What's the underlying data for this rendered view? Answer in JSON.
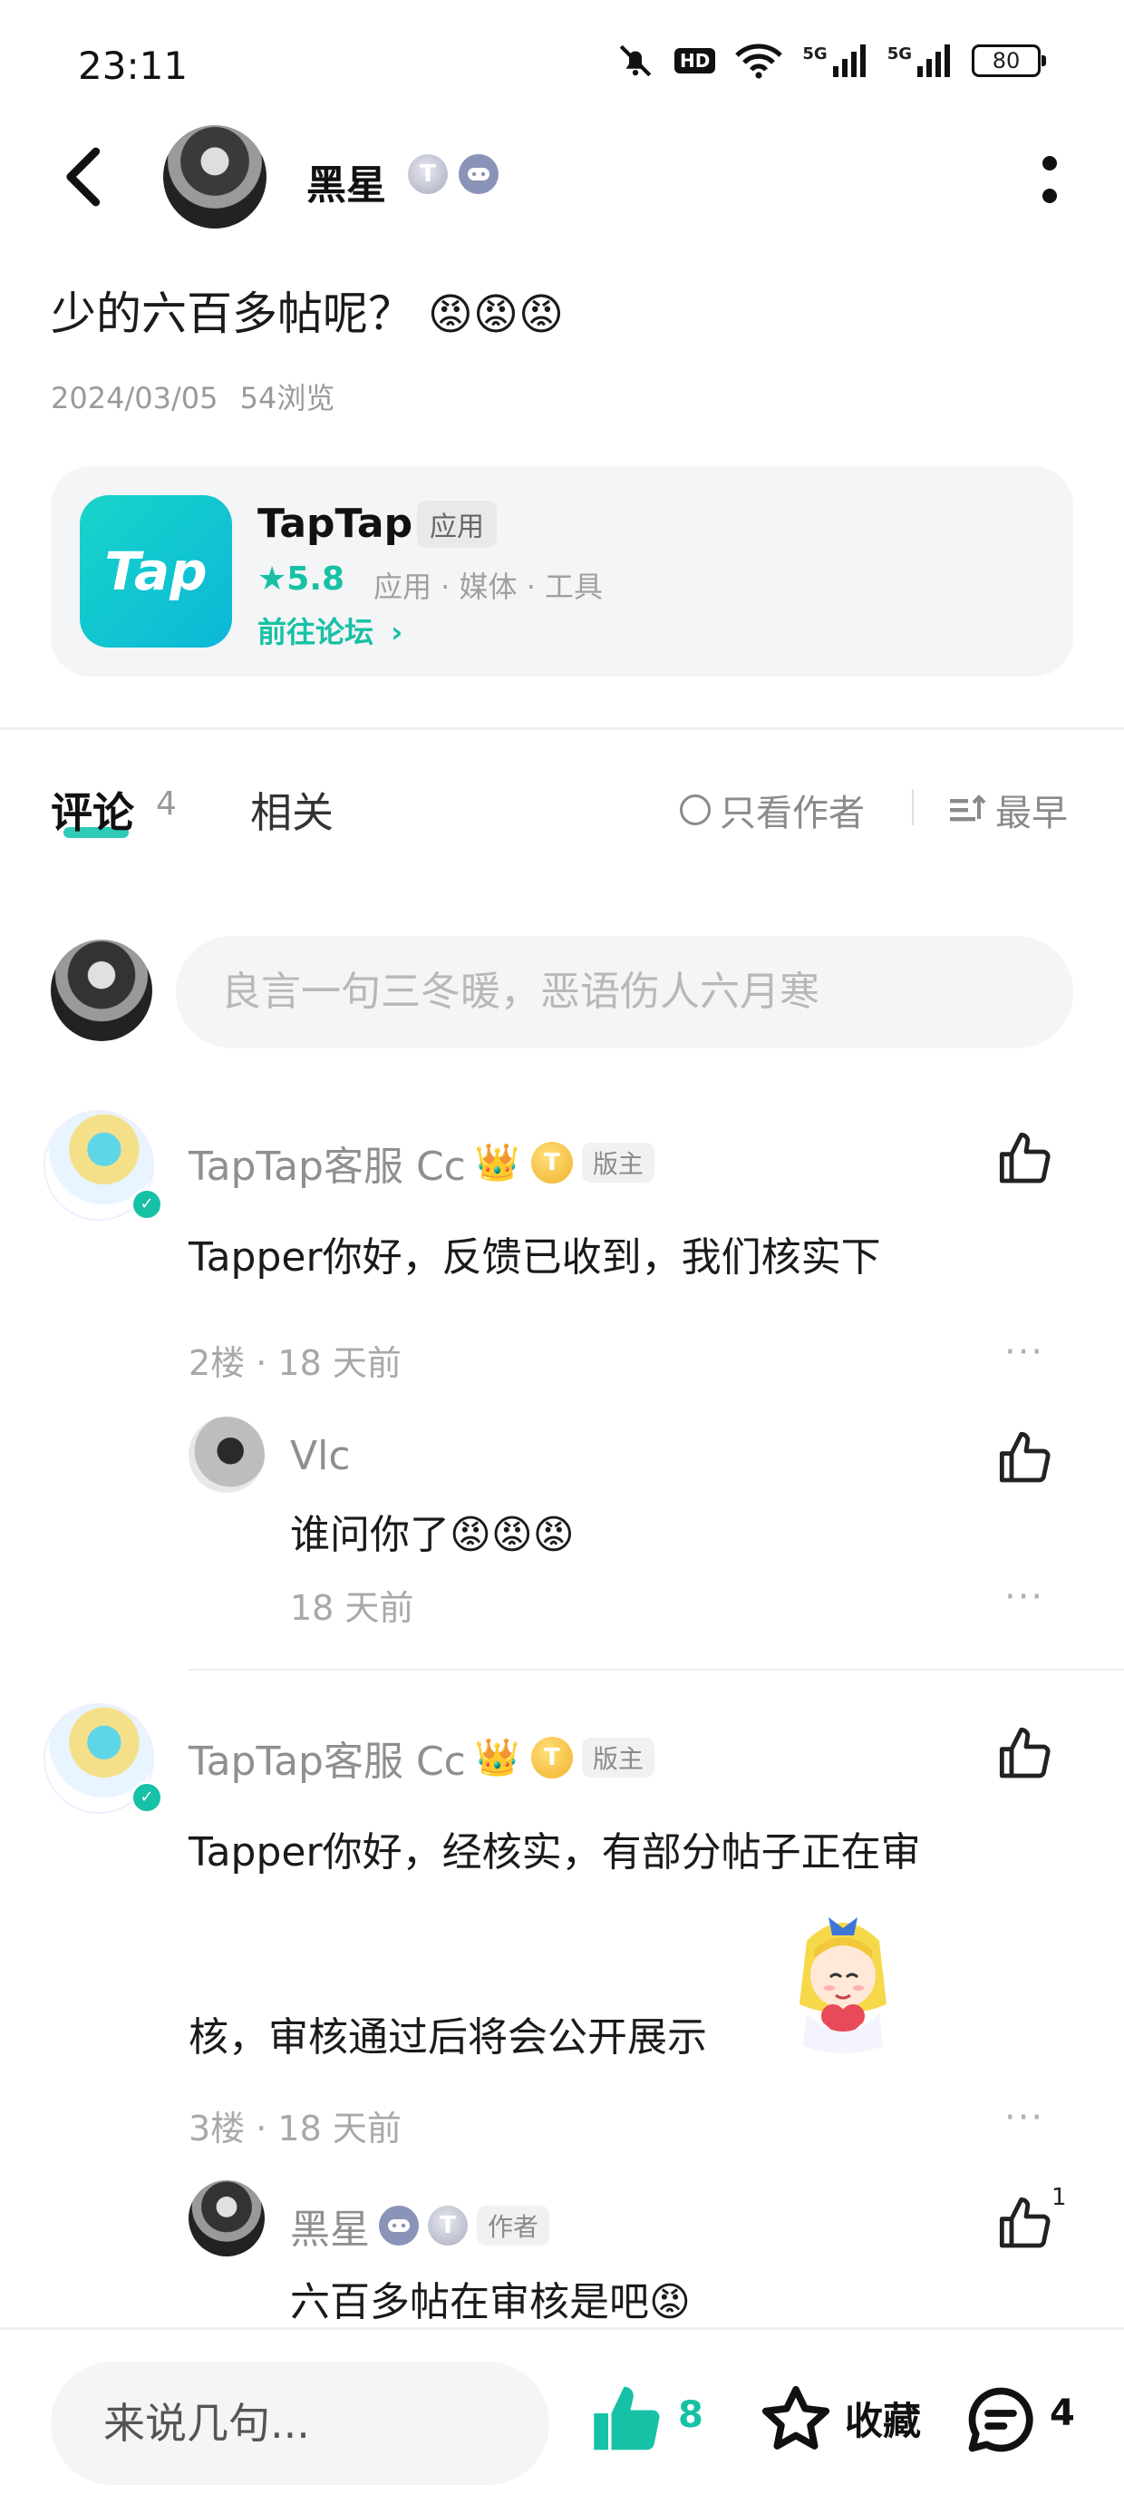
{
  "status_bar": {
    "time": "23:11",
    "network_label": "5G",
    "network_label_2": "5G",
    "hd_label": "HD",
    "battery": "80"
  },
  "header": {
    "author_name": "黑星",
    "badge_letter": "T"
  },
  "post": {
    "title": "少的六百多帖呢？",
    "title_emojis": "😡😡😡",
    "date": "2024/03/05",
    "views": "54浏览"
  },
  "app_card": {
    "icon_text": "Tap",
    "name": "TapTap",
    "tag": "应用",
    "rating_star": "★",
    "rating": "5.8",
    "categories": "应用 · 媒体 · 工具",
    "forum_link": "前往论坛",
    "forum_arrow": "›"
  },
  "tabs": {
    "comments_label": "评论",
    "comments_count": "4",
    "related_label": "相关",
    "only_author": "只看作者",
    "sort": "最早"
  },
  "composer": {
    "placeholder": "良言一句三冬暖，恶语伤人六月寒"
  },
  "comments": [
    {
      "name": "TapTap客服 Cc",
      "crown": "👑",
      "badge_letter": "T",
      "role": "版主",
      "verify": "✓",
      "text": "Tapper你好，反馈已收到，我们核实下",
      "meta": "2楼 · 18 天前",
      "reply": {
        "name": "Vlc",
        "text": "谁问你了",
        "emojis": "😡😡😡",
        "meta": "18 天前"
      }
    },
    {
      "name": "TapTap客服 Cc",
      "crown": "👑",
      "badge_letter": "T",
      "role": "版主",
      "verify": "✓",
      "text_line1": "Tapper你好，经核实，有部分帖子正在审",
      "text_line2": "核，审核通过后将会公开展示",
      "meta": "3楼 · 18 天前",
      "reply": {
        "name": "黑星",
        "badge_letter": "T",
        "role": "作者",
        "text": "六百多帖在审核是吧",
        "emojis": "😡",
        "like_count": "1"
      }
    }
  ],
  "bottom_bar": {
    "input_placeholder": "来说几句...",
    "like_count": "8",
    "favorite_label": "收藏",
    "comment_count": "4"
  },
  "dots": "···"
}
